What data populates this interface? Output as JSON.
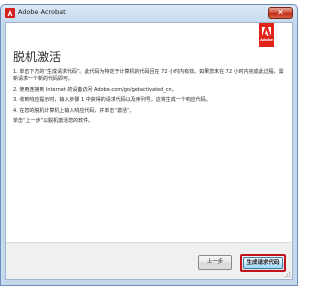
{
  "window": {
    "title": "Adobe Acrobat",
    "close_glyph": "✕",
    "app_icon": "adobe-acrobat-icon"
  },
  "brand": {
    "tag_text": "Adobe",
    "tag_color": "#e2231a"
  },
  "page": {
    "title": "脱机激活",
    "instructions": [
      "1. 单击下方的“生成请求代码”。此代码为特定于计算机的代码且在 72 小时内有效。如果您未在 72 小时内完成此过程，需新请求一个新的代码即可。",
      "2. 使用连接到 Internet 的设备访问 Adobe.com/go/getactivated_cn。",
      "3. 收到响应提示时，输入步骤 1 中获得的请求代码以及序列号。这将生成一个响应代码。",
      "4. 在您的脱机计算机上输入响应代码，并单击“激活”。",
      "单击“上一步”以脱机激活您的软件。"
    ]
  },
  "footer": {
    "back_label": "上一步",
    "generate_label": "生成请求代码"
  },
  "colors": {
    "highlight_border": "#c2141a",
    "window_frame": "#c5d9ee"
  }
}
